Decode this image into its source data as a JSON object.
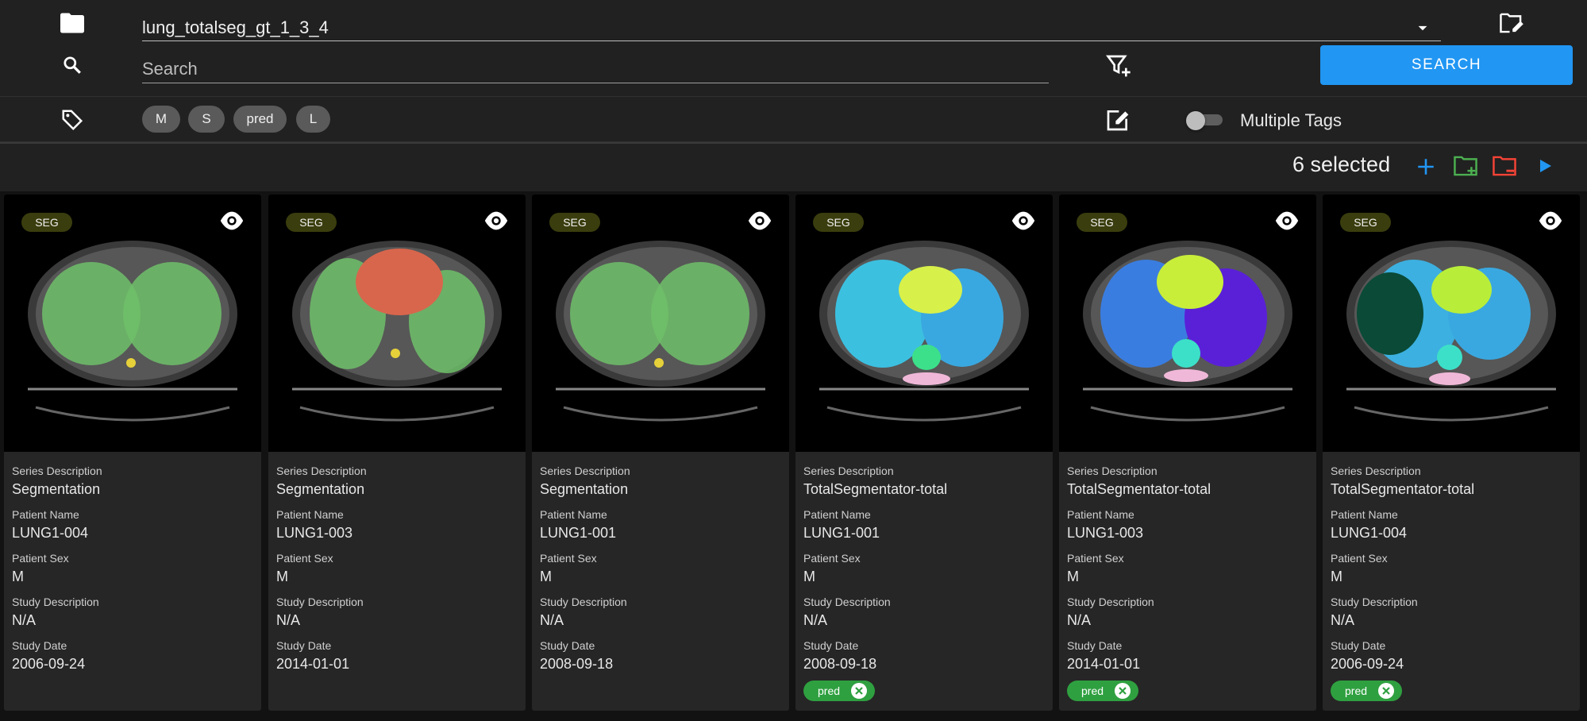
{
  "header": {
    "dataset": "lung_totalseg_gt_1_3_4"
  },
  "search": {
    "placeholder": "Search",
    "button_label": "SEARCH"
  },
  "tags": {
    "chips": [
      "M",
      "S",
      "pred",
      "L"
    ],
    "toggle_label": "Multiple Tags",
    "toggle_on": false
  },
  "selection": {
    "count_label": "6 selected"
  },
  "labels": {
    "series_description": "Series Description",
    "patient_name": "Patient Name",
    "patient_sex": "Patient Sex",
    "study_description": "Study Description",
    "study_date": "Study Date"
  },
  "cards": [
    {
      "badge": "SEG",
      "series_description": "Segmentation",
      "patient_name": "LUNG1-004",
      "patient_sex": "M",
      "study_description": "N/A",
      "study_date": "2006-09-24",
      "tag": ""
    },
    {
      "badge": "SEG",
      "series_description": "Segmentation",
      "patient_name": "LUNG1-003",
      "patient_sex": "M",
      "study_description": "N/A",
      "study_date": "2014-01-01",
      "tag": ""
    },
    {
      "badge": "SEG",
      "series_description": "Segmentation",
      "patient_name": "LUNG1-001",
      "patient_sex": "M",
      "study_description": "N/A",
      "study_date": "2008-09-18",
      "tag": ""
    },
    {
      "badge": "SEG",
      "series_description": "TotalSegmentator-total",
      "patient_name": "LUNG1-001",
      "patient_sex": "M",
      "study_description": "N/A",
      "study_date": "2008-09-18",
      "tag": "pred"
    },
    {
      "badge": "SEG",
      "series_description": "TotalSegmentator-total",
      "patient_name": "LUNG1-003",
      "patient_sex": "M",
      "study_description": "N/A",
      "study_date": "2014-01-01",
      "tag": "pred"
    },
    {
      "badge": "SEG",
      "series_description": "TotalSegmentator-total",
      "patient_name": "LUNG1-004",
      "patient_sex": "M",
      "study_description": "N/A",
      "study_date": "2006-09-24",
      "tag": "pred"
    }
  ],
  "colors": {
    "accent": "#2196f3",
    "add_folder": "#4caf50",
    "remove_folder": "#f44336",
    "pred_tag": "#2fa040"
  }
}
